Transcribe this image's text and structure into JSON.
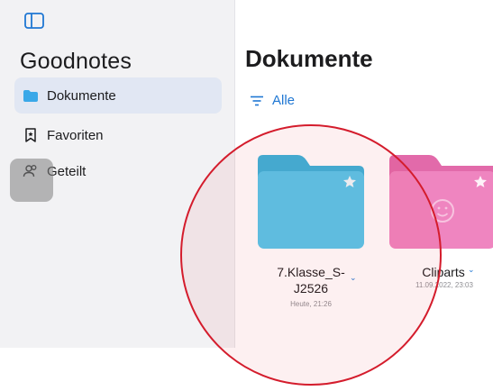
{
  "sidebar": {
    "app_title": "Goodnotes",
    "items": [
      {
        "label": "Dokumente",
        "icon": "folder-icon",
        "active": true
      },
      {
        "label": "Favoriten",
        "icon": "bookmark-icon",
        "active": false
      },
      {
        "label": "Geteilt",
        "icon": "people-icon",
        "active": false
      }
    ]
  },
  "main": {
    "title": "Dokumente",
    "filter_label": "Alle",
    "folders": [
      {
        "name_line1": "7.Klasse_S-",
        "name_line2": "J2526",
        "date": "Heute, 21:26",
        "color": "#4ec4e6",
        "starred": true
      },
      {
        "name_line1": "Cliparts",
        "date": "11.09.2022, 23:03",
        "color": "#ee7fbf",
        "starred": true
      }
    ]
  },
  "colors": {
    "accent": "#1f77d3",
    "highlight": "#d41c2c"
  }
}
